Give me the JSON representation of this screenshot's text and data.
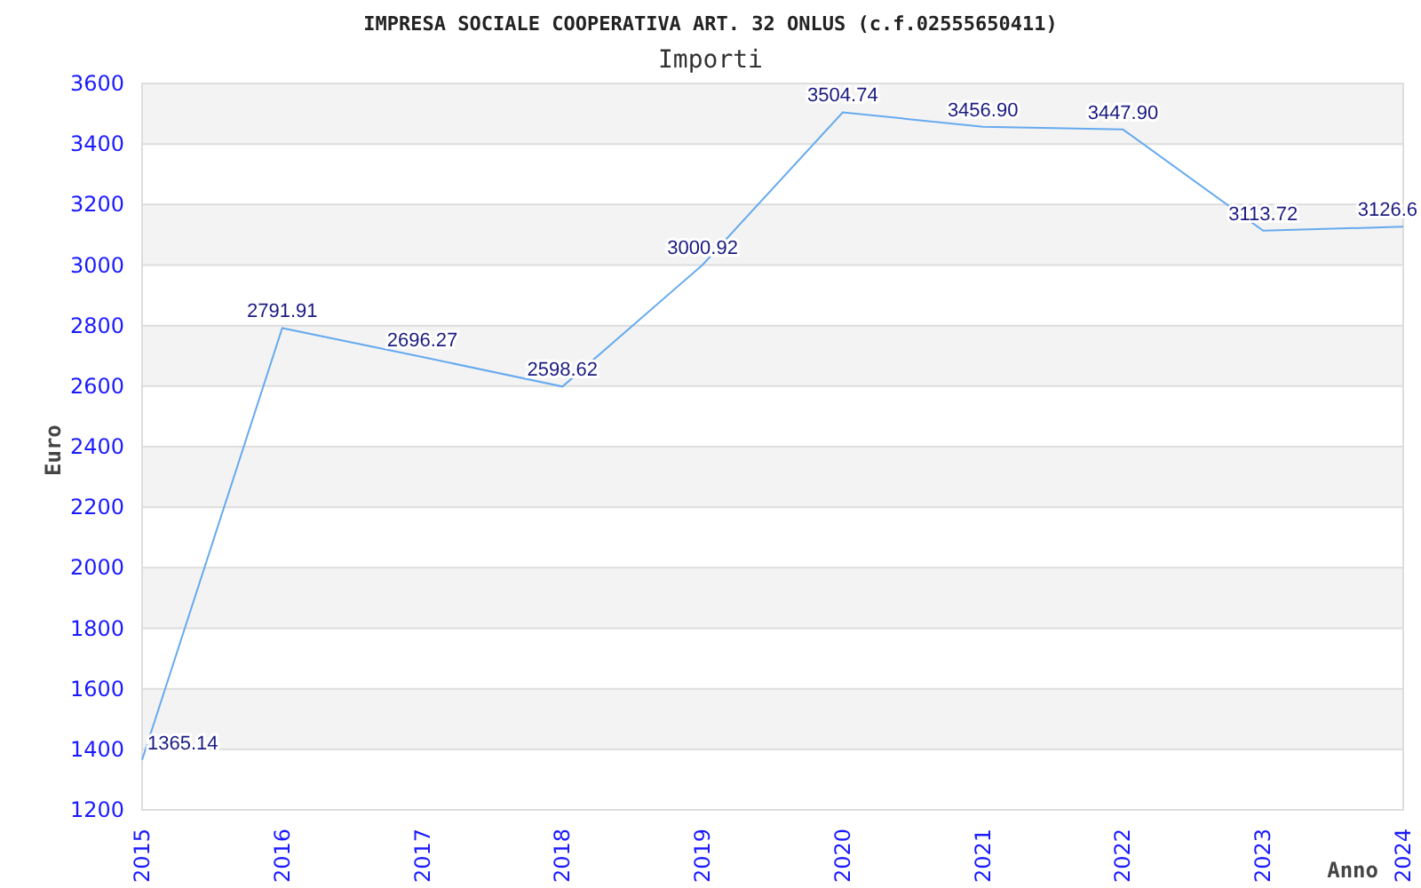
{
  "chart": {
    "chart_data": {
      "type": "line",
      "title": "IMPRESA SOCIALE COOPERATIVA ART. 32 ONLUS (c.f.02555650411)",
      "xlabel": "Anno",
      "ylabel": "Euro",
      "categories": [
        "2015",
        "2016",
        "2017",
        "2018",
        "2019",
        "2020",
        "2021",
        "2022",
        "2023",
        "2024"
      ],
      "series": [
        {
          "name": "Importi",
          "color": "#66aaee",
          "values": [
            1365.14,
            2791.91,
            2696.27,
            2598.62,
            3000.92,
            3504.74,
            3456.9,
            3447.9,
            3113.72,
            3126.6
          ]
        }
      ],
      "ylim": [
        1200,
        3600
      ],
      "yticks": [
        1200,
        1400,
        1600,
        1800,
        2000,
        2200,
        2400,
        2600,
        2800,
        3000,
        3200,
        3400,
        3600
      ],
      "grid": true,
      "value_labels": [
        "1365.14",
        "2791.91",
        "2696.27",
        "2598.62",
        "3000.92",
        "3504.74",
        "3456.90",
        "3447.90",
        "3113.72",
        "3126.6"
      ]
    }
  }
}
